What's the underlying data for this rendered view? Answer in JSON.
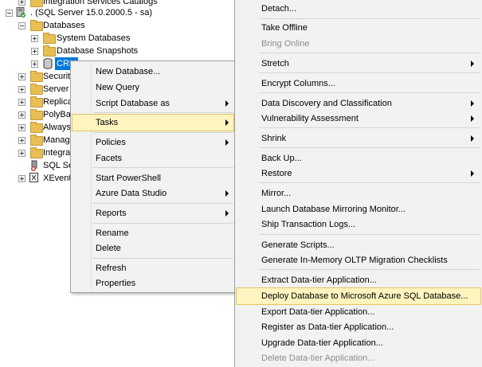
{
  "tree": {
    "integration_catalogs": "Integration Services Catalogs",
    "server": ". (SQL Server 15.0.2000.5 - sa)",
    "databases": "Databases",
    "system_databases": "System Databases",
    "database_snapshots": "Database Snapshots",
    "selected_db": "CRM",
    "security": "Securit",
    "server_objects": "Server O",
    "replication": "Replica",
    "polybase": "PolyBas",
    "always_on": "Always",
    "management": "Manag",
    "integration_services": "Integrat",
    "sql_agent": "SQL Ser",
    "xevent": "XEvent"
  },
  "context_menu": {
    "items": [
      "New Database...",
      "New Query",
      "Script Database as",
      "Tasks",
      "Policies",
      "Facets",
      "Start PowerShell",
      "Azure Data Studio",
      "Reports",
      "Rename",
      "Delete",
      "Refresh",
      "Properties"
    ]
  },
  "tasks_menu": {
    "items": [
      "Detach...",
      "Take Offline",
      "Bring Online",
      "Stretch",
      "Encrypt Columns...",
      "Data Discovery and Classification",
      "Vulnerability Assessment",
      "Shrink",
      "Back Up...",
      "Restore",
      "Mirror...",
      "Launch Database Mirroring Monitor...",
      "Ship Transaction Logs...",
      "Generate Scripts...",
      "Generate In-Memory OLTP Migration Checklists",
      "Extract Data-tier Application...",
      "Deploy Database to Microsoft Azure SQL Database...",
      "Export Data-tier Application...",
      "Register as Data-tier Application...",
      "Upgrade Data-tier Application...",
      "Delete Data-tier Application..."
    ]
  },
  "colors": {
    "selection": "#0078d7",
    "menu_highlight": "#fdf4bf",
    "menu_bg": "#f2f2f2"
  }
}
